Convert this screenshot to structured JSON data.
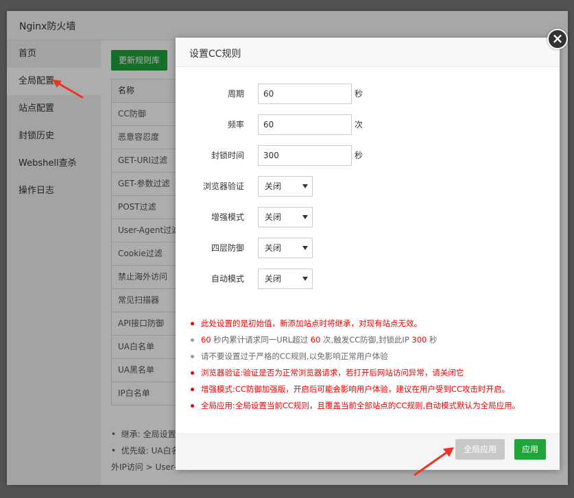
{
  "background_window": {
    "title": "Nginx防火墙",
    "nav": [
      {
        "label": "首页"
      },
      {
        "label": "全局配置"
      },
      {
        "label": "站点配置"
      },
      {
        "label": "封锁历史"
      },
      {
        "label": "Webshell查杀"
      },
      {
        "label": "操作日志"
      }
    ],
    "update_rules_button": "更新规则库",
    "table_header": "名称",
    "table_rows": [
      "CC防御",
      "恶意容忍度",
      "GET-URI过滤",
      "GET-参数过滤",
      "POST过滤",
      "User-Agent过滤",
      "Cookie过滤",
      "禁止海外访问",
      "常见扫描器",
      "API接口防御",
      "UA白名单",
      "UA黑名单",
      "IP白名单"
    ],
    "notes": [
      "继承: 全局设置",
      "优先级: UA白名",
      "外IP访问 > User-"
    ]
  },
  "dialog": {
    "title": "设置CC规则",
    "fields": {
      "period": {
        "label": "周期",
        "value": "60",
        "unit": "秒"
      },
      "frequency": {
        "label": "频率",
        "value": "60",
        "unit": "次"
      },
      "block_time": {
        "label": "封锁时间",
        "value": "300",
        "unit": "秒"
      },
      "browser_verify": {
        "label": "浏览器验证",
        "value": "关闭"
      },
      "enhanced_mode": {
        "label": "增强模式",
        "value": "关闭"
      },
      "layer4_defense": {
        "label": "四层防御",
        "value": "关闭"
      },
      "auto_mode": {
        "label": "自动模式",
        "value": "关闭"
      }
    },
    "tips": {
      "t1": "此处设置的是初始值，新添加站点时将继承，对现有站点无效。",
      "t2": {
        "a": "60",
        "b": " 秒内累计请求同一URL超过 ",
        "c": "60",
        "d": " 次,触发CC防御,封锁此IP ",
        "e": "300",
        "f": " 秒"
      },
      "t3": "请不要设置过于严格的CC规则,以免影响正常用户体验",
      "t4": "浏览器验证:验证是否为正常浏览器请求，若打开后网站访问异常，请关闭它",
      "t5": "增强模式:CC防御加强版，开启后可能会影响用户体验，建议在用户受到CC攻击时开启。",
      "t6": "全局应用:全局设置当前CC规则，且覆盖当前全部站点的CC规则,自动模式默认为全局应用。"
    },
    "buttons": {
      "global_apply": "全局应用",
      "apply": "应用"
    },
    "close_glyph": "×"
  },
  "colors": {
    "accent_green": "#20a53a",
    "warn_red": "#e00000",
    "arrow_red": "#ee3322"
  }
}
